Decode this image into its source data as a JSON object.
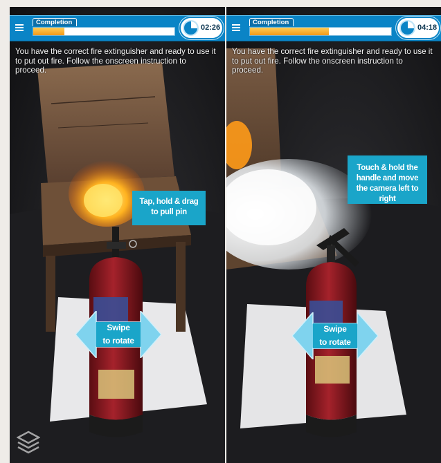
{
  "panels": [
    {
      "id": "left",
      "completion_label": "Completion",
      "progress_percent": 22,
      "timer": "02:26",
      "instruction": "You have the correct fire extinguisher and ready to use it to put out fire. Follow the onscreen instruction to proceed.",
      "hint": "Tap, hold & drag to pull pin",
      "swipe_line1": "Swipe",
      "swipe_line2": "to rotate"
    },
    {
      "id": "right",
      "completion_label": "Completion",
      "progress_percent": 56,
      "timer": "04:18",
      "instruction": "You have the correct fire extinguisher and ready to use it to put out fire. Follow the onscreen instruction to proceed.",
      "hint": "Touch & hold the handle and move the camera left to right",
      "swipe_line1": "Swipe",
      "swipe_line2": "to rotate"
    }
  ],
  "colors": {
    "accent": "#0a84c6",
    "progress": "#f39a18",
    "hint_bg": "#1aa5c9",
    "extinguisher_red": "#8e1a22"
  },
  "icons": [
    "menu-icon",
    "timer-icon",
    "swipe-arrow-icon",
    "vuforia-logo-icon"
  ]
}
